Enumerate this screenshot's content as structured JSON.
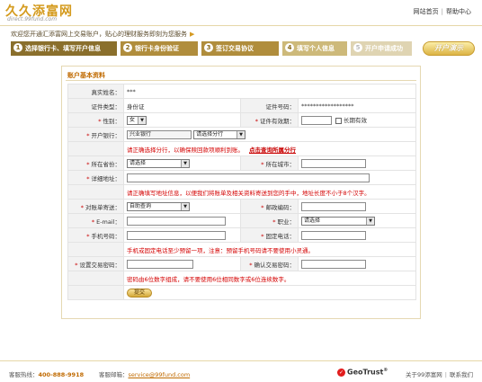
{
  "header": {
    "logo_text": "久久添富网",
    "logo_url": "direct.99fund.com",
    "home_link": "网站首页",
    "help_link": "帮助中心",
    "sep": "|"
  },
  "welcome": {
    "text": "欢迎您开通汇添富网上交易账户，贴心的理财服务即刻为您服务",
    "arrow": "▶"
  },
  "steps": [
    {
      "num": "1",
      "label": "选择银行卡、填写开户信息"
    },
    {
      "num": "2",
      "label": "银行卡身份验证"
    },
    {
      "num": "3",
      "label": "签订交易协议"
    },
    {
      "num": "4",
      "label": "填写个人信息"
    },
    {
      "num": "5",
      "label": "开户申请成功"
    }
  ],
  "open_button": "开户演示",
  "form": {
    "title": "账户基本资料",
    "real_name_label": "真实姓名：",
    "real_name_value": "***",
    "id_type_label": "证件类型：",
    "id_type_value": "身份证",
    "id_no_label": "证件号码：",
    "id_no_value": "******************",
    "gender_label": "性别：",
    "gender_value": "女",
    "id_valid_label": "证件有效期：",
    "long_valid_label": "长期有效",
    "bank_label": "开户银行：",
    "bank_value": "兴业银行",
    "branch_value": "请选择分行",
    "bank_note": "请正确选择分行，以确保赎回款项顺利到账。",
    "bank_query_link": "点击查询所属分行",
    "province_label": "所在省份：",
    "province_value": "请选择",
    "city_label": "所在城市：",
    "address_label": "详细地址：",
    "address_note": "请正确填写地址信息，以便我们将账单及相关资料寄送到您的手中，地址长度不小于8个汉字。",
    "statement_label": "对账单寄送：",
    "statement_value": "自助查询",
    "zip_label": "邮政编码：",
    "email_label": "E-mail：",
    "job_label": "职业：",
    "job_value": "请选择",
    "mobile_label": "手机号码：",
    "phone_label": "固定电话：",
    "contact_note": "手机或固定电话至少预留一项，注意：预留手机号码请不要使用小灵通。",
    "pwd_label": "设置交易密码：",
    "pwd_confirm_label": "确认交易密码：",
    "pwd_note": "密码由6位数字组成，请不要使用6位相同数字或6位连续数字。",
    "submit_label": "提交",
    "required_mark": "*"
  },
  "footer": {
    "hotline_label": "客服热线：",
    "hotline_value": "400-888-9918",
    "email_label": "客服邮箱：",
    "email_value": "service@99fund.com",
    "geotrust": "GeoTrust",
    "about_link": "关于99添富网",
    "contact_link": "联系我们",
    "sep": "|"
  }
}
